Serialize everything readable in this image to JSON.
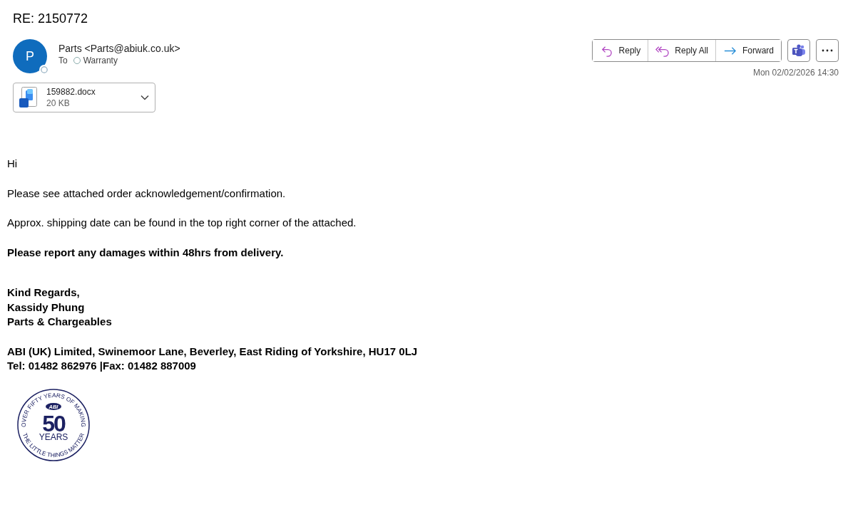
{
  "subject": "RE: 2150772",
  "sender": {
    "initial": "P",
    "name": "Parts <Parts@abiuk.co.uk>",
    "to_label": "To",
    "recipient": "Warranty"
  },
  "actions": [
    {
      "kind": "reply",
      "label": "Reply"
    },
    {
      "kind": "reply_all",
      "label": "Reply All"
    },
    {
      "kind": "forward",
      "label": "Forward"
    }
  ],
  "date": "Mon 02/02/2026 14:30",
  "attachment": {
    "name": "159882.docx",
    "size": "20 KB"
  },
  "body": [
    {
      "kind": "text",
      "bold": false,
      "lines": [
        "Hi"
      ]
    },
    {
      "kind": "text",
      "bold": false,
      "lines": [
        "Please see attached order acknowledgement/confirmation."
      ]
    },
    {
      "kind": "text",
      "bold": false,
      "lines": [
        "Approx. shipping date can be found in the top right corner of the attached."
      ]
    },
    {
      "kind": "text",
      "bold": true,
      "lines": [
        "Please report any damages within 48hrs from delivery."
      ]
    },
    {
      "kind": "signature",
      "bold": true,
      "lines": [
        "Kind Regards,",
        "Kassidy Phung",
        "Parts & Chargeables"
      ]
    },
    {
      "kind": "text",
      "bold": true,
      "lines": [
        "ABI (UK) Limited, Swinemoor Lane, Beverley, East Riding of Yorkshire, HU17 0LJ",
        "Tel: 01482 862976 |Fax: 01482 887009"
      ]
    }
  ],
  "logo": {
    "arc_top": "OVER FIFTY YEARS OF MAKING",
    "brand": "ABI",
    "number": "50",
    "unit": "YEARS",
    "arc_bottom": "THE LITTLE THINGS MATTER"
  }
}
